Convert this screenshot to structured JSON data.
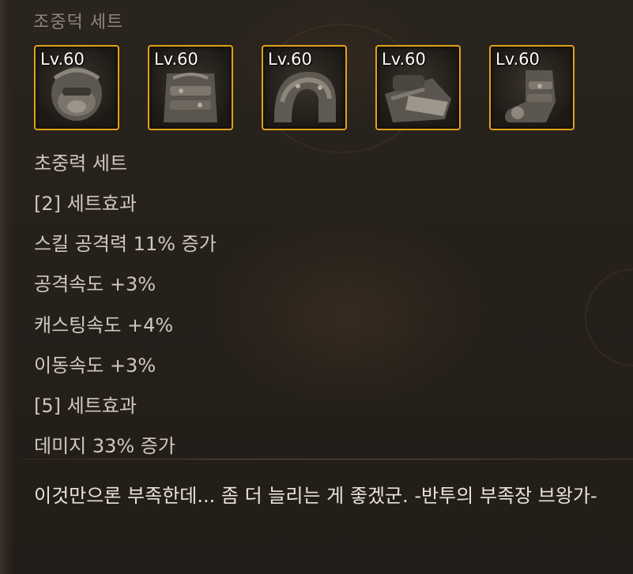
{
  "tooltip": {
    "header": "조중덕 세트",
    "slots": [
      {
        "level": "Lv.60",
        "icon": "helmet-armor-icon"
      },
      {
        "level": "Lv.60",
        "icon": "chest-armor-icon"
      },
      {
        "level": "Lv.60",
        "icon": "shoulder-armor-icon"
      },
      {
        "level": "Lv.60",
        "icon": "gauntlet-armor-icon"
      },
      {
        "level": "Lv.60",
        "icon": "boots-armor-icon"
      }
    ],
    "slot_border_color": "#e0a21a",
    "set_name": "초중력 세트",
    "effects": [
      "[2] 세트효과",
      "스킬 공격력 11% 증가",
      "공격속도 +3%",
      "캐스팅속도 +4%",
      "이동속도 +3%",
      "[5] 세트효과",
      "데미지 33% 증가"
    ],
    "flavor_text": "이것만으론 부족한데... 좀 더 늘리는 게 좋겠군. -반투의 부족장 브왕가-"
  }
}
